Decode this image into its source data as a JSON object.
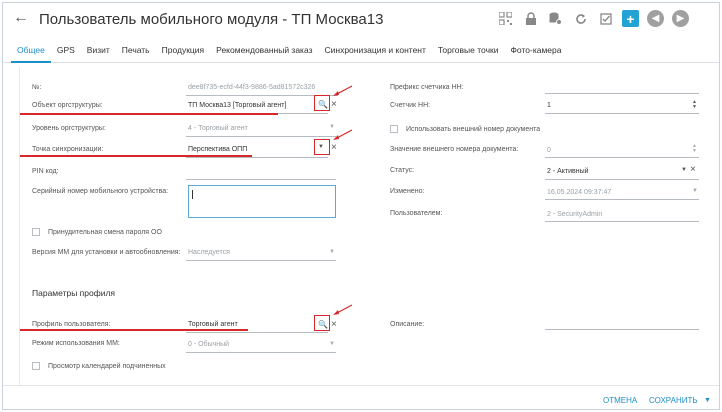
{
  "header": {
    "back_icon": "arrow-left-icon",
    "title": "Пользователь мобильного модуля - ТП Москва13",
    "toolbar_icons": [
      "qr-icon",
      "lock-icon",
      "db-settings-icon",
      "refresh-icon",
      "checkbox-icon",
      "add-icon",
      "prev-icon",
      "next-icon"
    ]
  },
  "tabs": [
    "Общее",
    "GPS",
    "Визит",
    "Печать",
    "Продукция",
    "Рекомендованный заказ",
    "Синхронизация и контент",
    "Торговые точки",
    "Фото-камера"
  ],
  "left": {
    "number_label": "№:",
    "number_value": "dee8f735-ecfd-44f3-9886-5ad81572c326",
    "org_object_label": "Объект оргструктуры:",
    "org_object_value": "ТП Москва13 [Торговый агент]",
    "org_level_label": "Уровень оргструктуры:",
    "org_level_value": "4 - Торговый агент",
    "sync_point_label": "Точка синхронизации:",
    "sync_point_value": "Перспектива ОПП",
    "pin_label": "PIN код:",
    "serial_label": "Серийный номер мобильного устройства:",
    "force_change_label": "Принудительная смена пароля ОО",
    "version_label": "Версия ММ для установки и автообновления:",
    "version_value": "Наследуется"
  },
  "right": {
    "prefix_label": "Префикс счетчика НН:",
    "counter_label": "Счетчик НН:",
    "counter_value": "1",
    "use_external_label": "Использовать внешний номер документа",
    "external_value_label": "Значение внешнего номера документа:",
    "external_value": "0",
    "status_label": "Статус:",
    "status_value": "2 - Активный",
    "changed_label": "Изменено:",
    "changed_value": "16.05.2024 09:37:47",
    "user_label": "Пользователем:",
    "user_value": "2 - SecurityAdmin"
  },
  "profile": {
    "section_title": "Параметры профиля",
    "profile_label": "Профиль пользователя:",
    "profile_value": "Торговый агент",
    "mode_label": "Режим использования ММ:",
    "mode_value": "0 - Обычный",
    "calendar_label": "Просмотр календарей подчиненных",
    "description_label": "Описание:"
  },
  "footer": {
    "cancel": "ОТМЕНА",
    "save": "СОХРАНИТЬ"
  },
  "colors": {
    "accent": "#1d8fc9",
    "annotation_red": "#d62828"
  }
}
